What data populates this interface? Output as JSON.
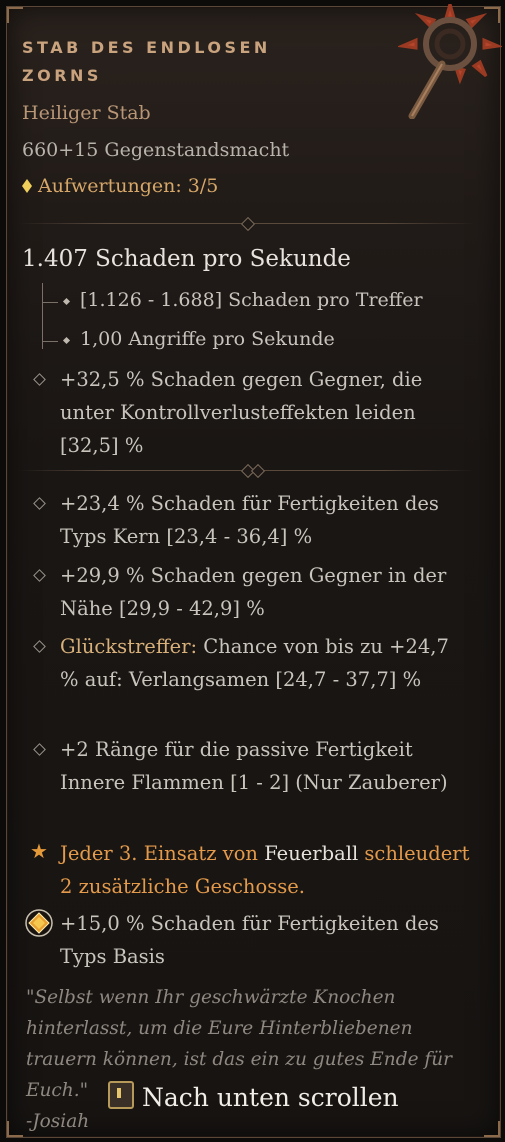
{
  "item": {
    "name": "STAB DES ENDLOSEN ZORNS",
    "type": "Heiliger Stab",
    "item_power": "660+15 Gegenstandsmacht",
    "upgrades": "Aufwertungen: 3/5"
  },
  "stats": {
    "dps": "1.407 Schaden pro Sekunde",
    "damage_per_hit": "[1.126 - 1.688] Schaden pro Treffer",
    "attacks_per_second": "1,00 Angriffe pro Sekunde",
    "implicit": "+32,5 % Schaden gegen Gegner, die unter Kontrollverlusteffekten leiden [32,5] %"
  },
  "affixes": [
    "+23,4 % Schaden für Fertigkeiten des Typs Kern [23,4 - 36,4] %",
    "+29,9 % Schaden gegen Gegner in der Nähe [29,9 - 42,9] %"
  ],
  "lucky_hit": {
    "label": "Glückstreffer:",
    "text": " Chance von bis zu +24,7 % auf: Verlangsamen [24,7 - 37,7] %"
  },
  "rank_affix": "+2 Ränge für die passive Fertigkeit Innere Flammen [1 - 2] (Nur Zauberer)",
  "legendary": {
    "part1": "Jeder 3. Einsatz von ",
    "skill": "Feuerball",
    "part2": " schleudert 2 zusätzliche Geschosse."
  },
  "gem_affix": "+15,0 % Schaden für Fertigkeiten des Typs Basis",
  "flavor": {
    "quote": "\"Selbst wenn Ihr geschwärzte Knochen hinterlasst, um die Eure Hinterbliebenen trauern können, ist das ein zu gutes Ende für Euch.\"",
    "author": "-Josiah"
  },
  "footer": {
    "scroll_label": "Nach unten scrollen"
  },
  "colors": {
    "title": "#c9a27e",
    "legendary": "#e39a4b",
    "upgrade": "#d6a768"
  },
  "icons": [
    "staff-icon",
    "upgrade-diamond-icon",
    "affix-bullet-icon",
    "legendary-star-icon",
    "gem-socket-icon",
    "scroll-key-icon"
  ]
}
